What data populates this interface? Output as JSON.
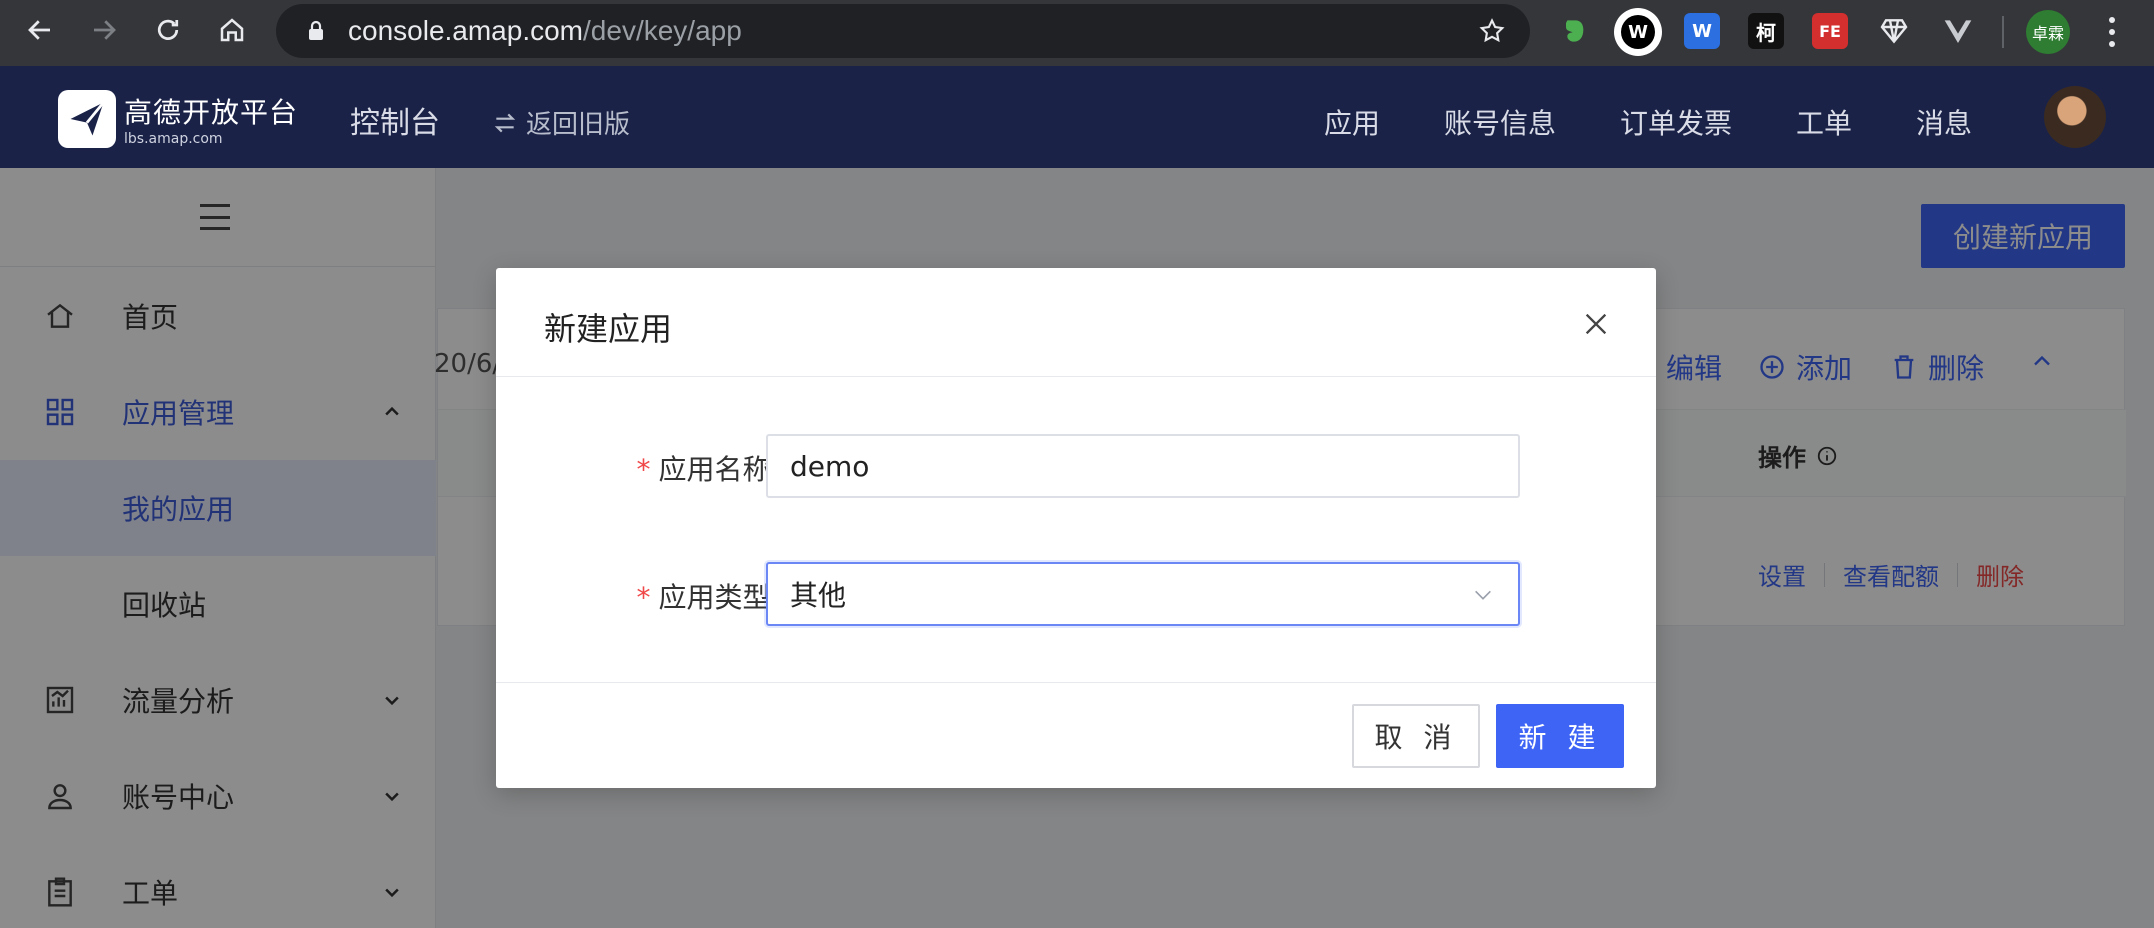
{
  "browser": {
    "url_host": "console.amap.com",
    "url_path": "/dev/key/app",
    "profile": "卓霖",
    "extensions": [
      "evernote-icon",
      "wappalyzer-icon",
      "word-icon",
      "ke-icon",
      "fe-icon",
      "diamond-icon",
      "vue-icon"
    ],
    "extension_labels": {
      "ke": "柯",
      "fe": "FE",
      "w": "W"
    }
  },
  "header": {
    "logo_cn": "高德开放平台",
    "logo_en": "lbs.amap.com",
    "console": "控制台",
    "back_label": "返回旧版",
    "nav": [
      "应用",
      "账号信息",
      "订单发票",
      "工单",
      "消息"
    ]
  },
  "sidebar": {
    "items": [
      {
        "label": "首页",
        "icon": "home-icon"
      },
      {
        "label": "应用管理",
        "icon": "grid-icon"
      },
      {
        "label": "我的应用"
      },
      {
        "label": "回收站"
      },
      {
        "label": "流量分析",
        "icon": "chart-icon"
      },
      {
        "label": "账号中心",
        "icon": "user-icon"
      },
      {
        "label": "工单",
        "icon": "clipboard-icon"
      }
    ]
  },
  "main": {
    "create_button": "创建新应用",
    "card_date": "20/6/",
    "actions": {
      "edit": "编辑",
      "add": "添加",
      "delete": "删除"
    },
    "table": {
      "op_header": "操作"
    },
    "row_links": {
      "settings": "设置",
      "quota": "查看配额",
      "delete": "删除"
    }
  },
  "modal": {
    "title": "新建应用",
    "fields": [
      {
        "label": "应用名称",
        "value": "demo"
      },
      {
        "label": "应用类型",
        "value": "其他"
      }
    ],
    "cancel": "取 消",
    "ok": "新 建"
  },
  "colors": {
    "header_bg": "#1a2248",
    "primary": "#3e64f5",
    "danger": "#f04848",
    "browser_bg": "#35363a"
  }
}
